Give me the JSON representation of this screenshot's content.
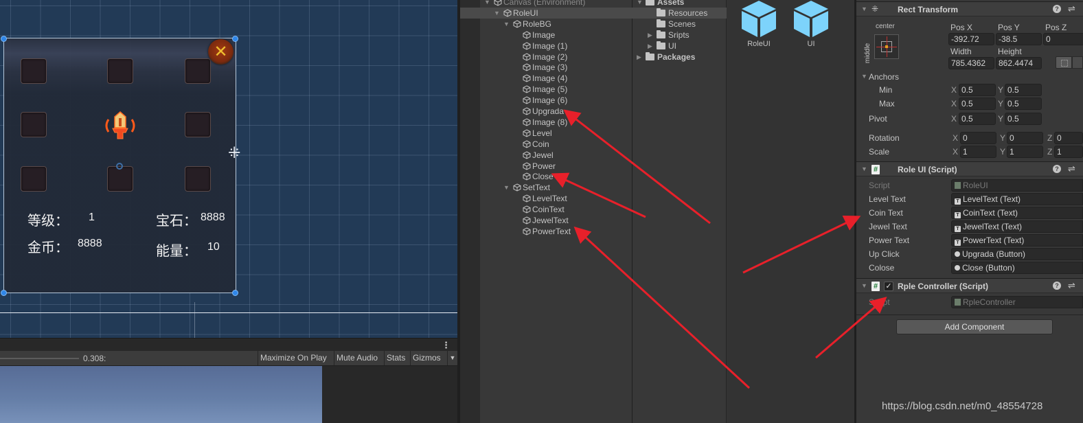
{
  "scene": {
    "stats": {
      "level_label": "等级：",
      "level_value": "1",
      "coin_label": "金币：",
      "coin_value": "8888",
      "jewel_label": "宝石：",
      "jewel_value": "8888",
      "power_label": "能量：",
      "power_value": "10"
    },
    "close_glyph": "✕",
    "move_glyph": "⁜"
  },
  "game_toolbar": {
    "scale_value": "0.308:",
    "buttons": [
      "Maximize On Play",
      "Mute Audio",
      "Stats",
      "Gizmos"
    ],
    "gizmos_dropdown": "▼",
    "menu_glyph": "⋮"
  },
  "hierarchy": {
    "items": [
      {
        "label": "Canvas (Environment)",
        "depth": 0,
        "expanded": true
      },
      {
        "label": "RoleUI",
        "depth": 1,
        "expanded": true,
        "selected": true
      },
      {
        "label": "RoleBG",
        "depth": 2,
        "expanded": true
      },
      {
        "label": "Image",
        "depth": 3
      },
      {
        "label": "Image (1)",
        "depth": 3
      },
      {
        "label": "Image (2)",
        "depth": 3
      },
      {
        "label": "Image (3)",
        "depth": 3
      },
      {
        "label": "Image (4)",
        "depth": 3
      },
      {
        "label": "Image (5)",
        "depth": 3
      },
      {
        "label": "Image (6)",
        "depth": 3
      },
      {
        "label": "Upgrada",
        "depth": 3
      },
      {
        "label": "Image (8)",
        "depth": 3
      },
      {
        "label": "Level",
        "depth": 3
      },
      {
        "label": "Coin",
        "depth": 3
      },
      {
        "label": "Jewel",
        "depth": 3
      },
      {
        "label": "Power",
        "depth": 3
      },
      {
        "label": "Close",
        "depth": 3
      },
      {
        "label": "SetText",
        "depth": 2,
        "expanded": true
      },
      {
        "label": "LevelText",
        "depth": 3
      },
      {
        "label": "CoinText",
        "depth": 3
      },
      {
        "label": "JewelText",
        "depth": 3
      },
      {
        "label": "PowerText",
        "depth": 3
      }
    ]
  },
  "project": {
    "tree": [
      {
        "label": "Assets",
        "depth": 0,
        "expanded": true,
        "bold": true
      },
      {
        "label": "Resources",
        "depth": 1,
        "selected": true
      },
      {
        "label": "Scenes",
        "depth": 1
      },
      {
        "label": "Sripts",
        "depth": 1,
        "collapsed": true
      },
      {
        "label": "UI",
        "depth": 1,
        "collapsed": true
      },
      {
        "label": "Packages",
        "depth": 0,
        "collapsed": true,
        "bold": true
      }
    ],
    "assets": [
      {
        "name": "RoleUI",
        "icon": "prefab-cube-icon"
      },
      {
        "name": "UI",
        "icon": "prefab-cube-icon"
      }
    ],
    "prefab_color": "#7dd3fb"
  },
  "inspector": {
    "rect_transform": {
      "title": "Rect Transform",
      "anchor_h": "center",
      "anchor_v": "middle",
      "labels": {
        "pos_x": "Pos X",
        "pos_y": "Pos Y",
        "pos_z": "Pos Z",
        "width": "Width",
        "height": "Height"
      },
      "pos_x": "-392.72",
      "pos_y": "-38.5",
      "pos_z": "0",
      "width": "785.4362",
      "height": "862.4474",
      "anchors_label": "Anchors",
      "min_label": "Min",
      "max_label": "Max",
      "pivot_label": "Pivot",
      "rotation_label": "Rotation",
      "scale_label": "Scale",
      "axis_x": "X",
      "axis_y": "Y",
      "axis_z": "Z",
      "anchor_min": {
        "x": "0.5",
        "y": "0.5"
      },
      "anchor_max": {
        "x": "0.5",
        "y": "0.5"
      },
      "pivot": {
        "x": "0.5",
        "y": "0.5"
      },
      "rotation": {
        "x": "0",
        "y": "0",
        "z": "0"
      },
      "scale": {
        "x": "1",
        "y": "1",
        "z": "1"
      }
    },
    "role_ui_script": {
      "title": "Role UI (Script)",
      "fields": [
        {
          "label": "Script",
          "value": "RoleUI",
          "kind": "script",
          "dim": true
        },
        {
          "label": "Level Text",
          "value": "LevelText (Text)",
          "kind": "text"
        },
        {
          "label": "Coin Text",
          "value": "CoinText (Text)",
          "kind": "text"
        },
        {
          "label": "Jewel Text",
          "value": "JewelText (Text)",
          "kind": "text"
        },
        {
          "label": "Power Text",
          "value": "PowerText (Text)",
          "kind": "text"
        },
        {
          "label": "Up Click",
          "value": "Upgrada (Button)",
          "kind": "button"
        },
        {
          "label": "Colose",
          "value": "Close (Button)",
          "kind": "button"
        }
      ]
    },
    "rple_controller_script": {
      "title": "Rple Controller (Script)",
      "enabled": true,
      "check_glyph": "✓",
      "fields": [
        {
          "label": "Script",
          "value": "RpleController",
          "kind": "script",
          "dim": true
        }
      ]
    },
    "add_component_label": "Add Component",
    "help_glyph": "?",
    "presets_glyph": "⇌",
    "script_glyph": "#"
  },
  "watermark": "https://blog.csdn.net/m0_48554728",
  "annotation_color": "#e8202a"
}
